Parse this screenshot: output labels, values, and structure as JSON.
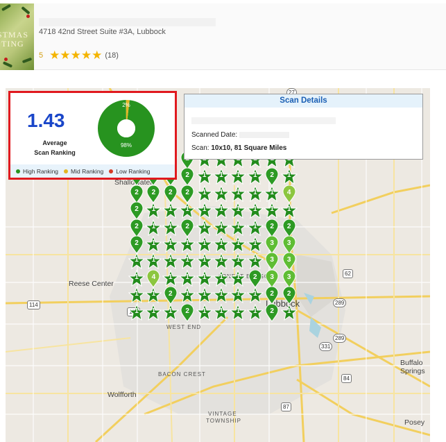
{
  "business": {
    "address": "4718 42nd Street Suite #3A, Lubbock",
    "rating_value": "5",
    "stars_count": 5,
    "review_count": "(18)",
    "thumbnail_text_1": "STMAS",
    "thumbnail_text_2": "TING"
  },
  "summary": {
    "average_value": "1.43",
    "average_label_1": "Average",
    "average_label_2": "Scan Ranking",
    "donut_segments": [
      {
        "name": "High Ranking",
        "percent": 98,
        "label": "98%",
        "color": "#27931f"
      },
      {
        "name": "Mid Ranking",
        "percent": 2,
        "label": "2%",
        "color": "#e3b624"
      },
      {
        "name": "Low Ranking",
        "percent": 0,
        "label": "",
        "color": "#d43a24"
      }
    ],
    "legend": [
      {
        "label": "High Ranking",
        "color": "#27931f"
      },
      {
        "label": "Mid Ranking",
        "color": "#e3b624"
      },
      {
        "label": "Low Ranking",
        "color": "#d43a24"
      }
    ]
  },
  "scan_details": {
    "title": "Scan Details",
    "date_label": "Scanned Date:",
    "scan_label": "Scan:",
    "scan_value": "10x10, 81 Square Miles"
  },
  "map_labels": {
    "shallowater": "Shallowater",
    "reese_center": "Reese Center",
    "wolfforth": "Wolfforth",
    "lubbock": "Lubbock",
    "buffalo": "Buffalo",
    "springs": "Springs",
    "posey": "Posey",
    "vintage": "VINTAGE",
    "township": "TOWNSHIP",
    "west_end": "WEST END",
    "arnett_benson": "ARNETT BENSON",
    "bacon_crest": "BACON CREST",
    "overton": "OVERTON",
    "tech": "TECH"
  },
  "shields": [
    "114",
    "114",
    "62",
    "289",
    "289",
    "331",
    "84",
    "87",
    "27"
  ],
  "grid": {
    "rows": [
      [
        "1",
        "2",
        "2",
        "2",
        "1",
        "1",
        "1",
        "1",
        "1",
        "1"
      ],
      [
        "2",
        "2",
        "2",
        "2",
        "1",
        "1",
        "1",
        "1",
        "2",
        "1"
      ],
      [
        "2",
        "2",
        "2",
        "2",
        "1",
        "1",
        "1",
        "1",
        "1",
        "4"
      ],
      [
        "2",
        "1",
        "1",
        "1",
        "1",
        "1",
        "1",
        "1",
        "1",
        "1"
      ],
      [
        "2",
        "1",
        "1",
        "2",
        "1",
        "1",
        "1",
        "1",
        "2",
        "2"
      ],
      [
        "2",
        "1",
        "1",
        "1",
        "1",
        "1",
        "1",
        "1",
        "3",
        "3"
      ],
      [
        "1",
        "1",
        "1",
        "1",
        "1",
        "1",
        "1",
        "1",
        "3",
        "3"
      ],
      [
        "1",
        "4",
        "1",
        "1",
        "1",
        "1",
        "1",
        "2",
        "3",
        "3"
      ],
      [
        "1",
        "1",
        "2",
        "1",
        "1",
        "1",
        "1",
        "1",
        "2",
        "2"
      ],
      [
        "1",
        "1",
        "1",
        "2",
        "1",
        "1",
        "1",
        "1",
        "2",
        "1"
      ]
    ],
    "colors": {
      "1": "#228b1c",
      "2": "#2d9a24",
      "3": "#5fbd34",
      "4": "#8cc63f"
    }
  }
}
